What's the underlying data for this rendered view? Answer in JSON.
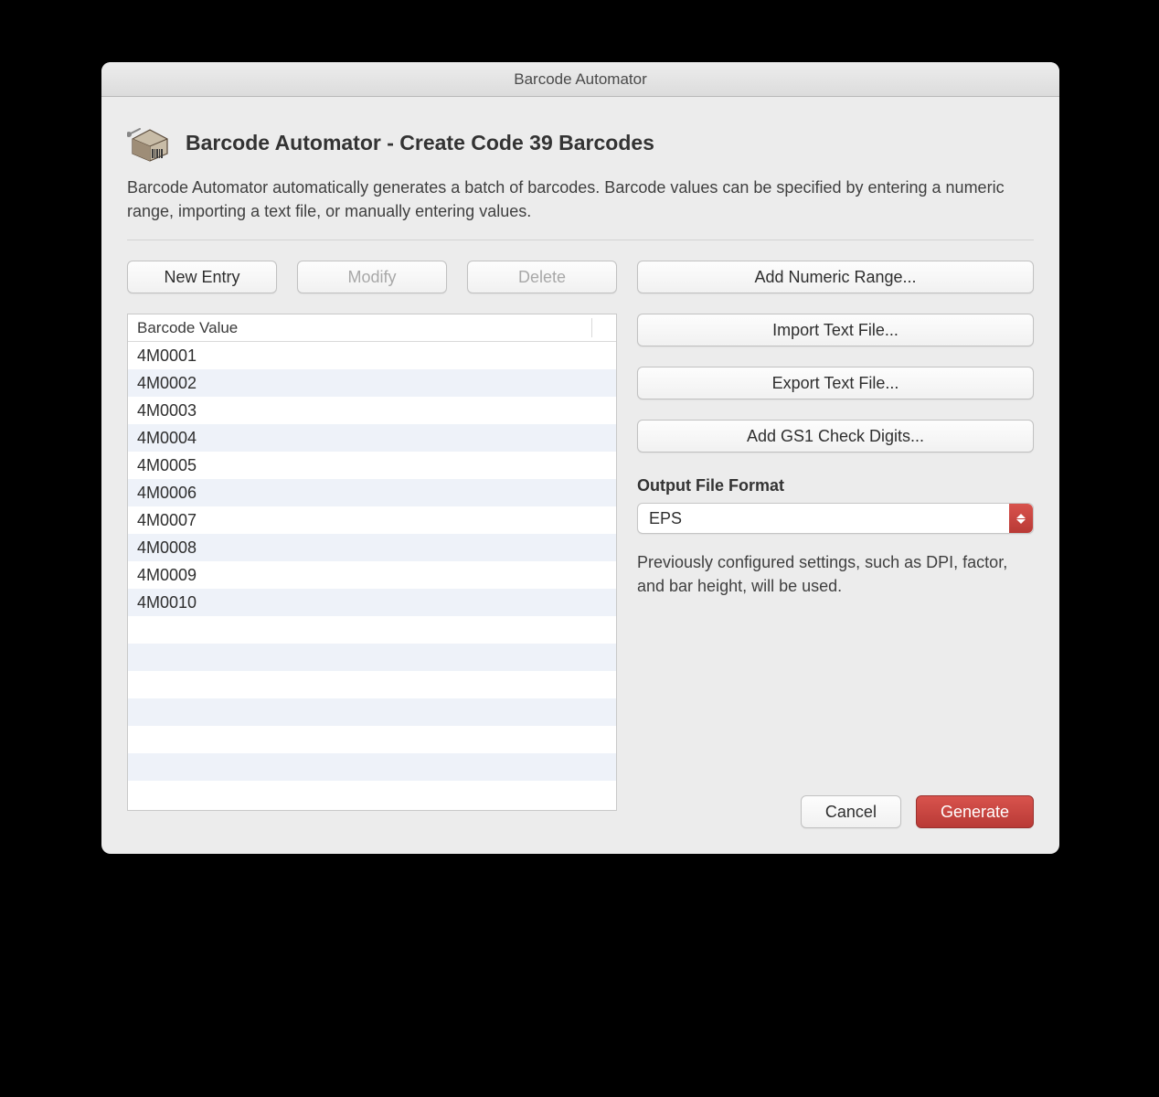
{
  "window_title": "Barcode Automator",
  "heading": "Barcode Automator - Create Code 39 Barcodes",
  "description": "Barcode Automator automatically generates a batch of barcodes. Barcode values can be specified by entering a numeric range, importing a text file, or manually entering values.",
  "buttons": {
    "new_entry": "New Entry",
    "modify": "Modify",
    "delete": "Delete",
    "add_numeric_range": "Add Numeric Range...",
    "import_text_file": "Import Text File...",
    "export_text_file": "Export Text File...",
    "add_gs1_check_digits": "Add GS1 Check Digits...",
    "cancel": "Cancel",
    "generate": "Generate"
  },
  "table": {
    "header": "Barcode Value",
    "rows": [
      "4M0001",
      "4M0002",
      "4M0003",
      "4M0004",
      "4M0005",
      "4M0006",
      "4M0007",
      "4M0008",
      "4M0009",
      "4M0010"
    ],
    "empty_row_count": 7
  },
  "output_format": {
    "label": "Output File Format",
    "selected": "EPS"
  },
  "hint": "Previously configured settings, such as DPI, factor, and bar height, will be used."
}
